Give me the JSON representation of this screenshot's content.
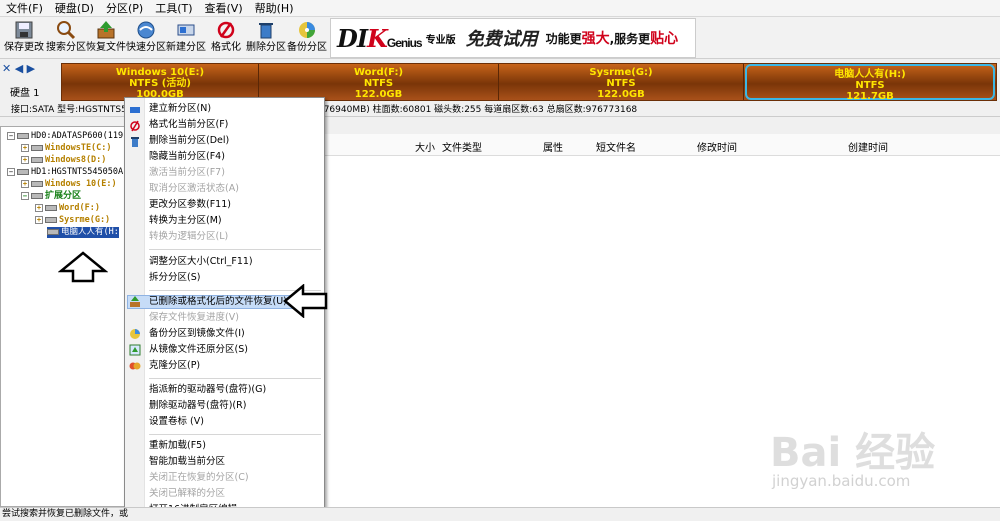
{
  "menubar": [
    "文件(F)",
    "硬盘(D)",
    "分区(P)",
    "工具(T)",
    "查看(V)",
    "帮助(H)"
  ],
  "toolbar": [
    {
      "label": "保存更改",
      "icon": "save-icon"
    },
    {
      "label": "搜索分区",
      "icon": "magnifier-icon"
    },
    {
      "label": "恢复文件",
      "icon": "recover-file-icon"
    },
    {
      "label": "快速分区",
      "icon": "quick-partition-icon"
    },
    {
      "label": "新建分区",
      "icon": "new-partition-icon"
    },
    {
      "label": "格式化",
      "icon": "format-icon"
    },
    {
      "label": "删除分区",
      "icon": "trash-icon"
    },
    {
      "label": "备份分区",
      "icon": "backup-icon"
    }
  ],
  "banner": {
    "logo_a": "DI",
    "logo_b": "K",
    "logo_c": "Genius",
    "edition": "专业版",
    "free": "免费试用",
    "slogan_a": "功能更",
    "slogan_b": "强大",
    "slogan_c": ",服务更",
    "slogan_d": "贴心"
  },
  "disk": {
    "label": "硬盘 1",
    "partitions": [
      {
        "name": "Windows 10(E:)",
        "fs": "NTFS (活动)",
        "size": "100.0GB",
        "selected": false
      },
      {
        "name": "Word(F:)",
        "fs": "NTFS",
        "size": "122.0GB",
        "selected": false
      },
      {
        "name": "Sysrme(G:)",
        "fs": "NTFS",
        "size": "122.0GB",
        "selected": false
      },
      {
        "name": "电脑人人有(H:)",
        "fs": "NTFS",
        "size": "121.7GB",
        "selected": true
      }
    ]
  },
  "infoline": {
    "left": "接口:SATA  型号:HGSTNTS545",
    "right": "B(476940MB) 柱面数:60801 磁头数:255 每道扇区数:63 总扇区数:976773168"
  },
  "tree": [
    {
      "text": "HD0:ADATASP600(119",
      "kind": "disk",
      "expander": "−"
    },
    {
      "text": "WindowsTE(C:)",
      "kind": "part",
      "expander": "+"
    },
    {
      "text": "Windows8(D:)",
      "kind": "part",
      "expander": "+"
    },
    {
      "text": "HD1:HGSTNTS545050A",
      "kind": "disk",
      "expander": "−"
    },
    {
      "text": "Windows 10(E:)",
      "kind": "part",
      "expander": "+"
    },
    {
      "text": "扩展分区",
      "kind": "ext",
      "expander": "−"
    },
    {
      "text": "Word(F:)",
      "kind": "part",
      "expander": "+"
    },
    {
      "text": "Sysrme(G:)",
      "kind": "part",
      "expander": "+"
    },
    {
      "text": "电脑人人有(H:",
      "kind": "selected",
      "expander": ""
    }
  ],
  "list_columns": [
    "大小",
    "文件类型",
    "属性",
    "短文件名",
    "修改时间",
    "创建时间"
  ],
  "context_menu": {
    "items": [
      {
        "label": "建立新分区(N)",
        "disabled": false
      },
      {
        "label": "格式化当前分区(F)",
        "disabled": false
      },
      {
        "label": "删除当前分区(Del)",
        "disabled": false
      },
      {
        "label": "隐藏当前分区(F4)",
        "disabled": false
      },
      {
        "label": "激活当前分区(F7)",
        "disabled": true
      },
      {
        "label": "取消分区激活状态(A)",
        "disabled": true
      },
      {
        "label": "更改分区参数(F11)",
        "disabled": false
      },
      {
        "label": "转换为主分区(M)",
        "disabled": false
      },
      {
        "label": "转换为逻辑分区(L)",
        "disabled": true
      },
      {
        "label": "调整分区大小(Ctrl_F11)",
        "disabled": false
      },
      {
        "label": "拆分分区(S)",
        "disabled": false
      },
      {
        "label": "已删除或格式化后的文件恢复(U)",
        "disabled": false,
        "highlighted": true
      },
      {
        "label": "保存文件恢复进度(V)",
        "disabled": true
      },
      {
        "label": "备份分区到镜像文件(I)",
        "disabled": false
      },
      {
        "label": "从镜像文件还原分区(S)",
        "disabled": false
      },
      {
        "label": "克隆分区(P)",
        "disabled": false
      },
      {
        "label": "指派新的驱动器号(盘符)(G)",
        "disabled": false
      },
      {
        "label": "删除驱动器号(盘符)(R)",
        "disabled": false
      },
      {
        "label": "设置卷标 (V)",
        "disabled": false
      },
      {
        "label": "重新加载(F5)",
        "disabled": false
      },
      {
        "label": "智能加载当前分区",
        "disabled": false
      },
      {
        "label": "关闭正在恢复的分区(C)",
        "disabled": true
      },
      {
        "label": "关闭已解释的分区",
        "disabled": true
      },
      {
        "label": "打开16进制扇区编辑",
        "disabled": false
      }
    ]
  },
  "status": "尝试搜索并恢复已删除文件，或",
  "watermark": {
    "main": "Bai 经验",
    "sub": "jingyan.baidu.com"
  }
}
